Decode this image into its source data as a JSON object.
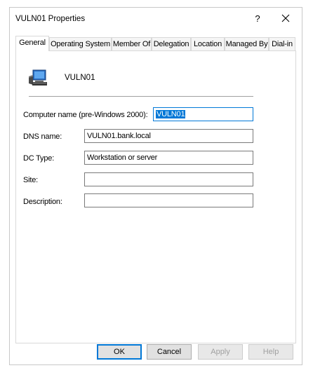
{
  "window": {
    "title": "VULN01 Properties",
    "help_label": "?",
    "close_icon": "close-icon"
  },
  "tabs": [
    {
      "label": "General",
      "active": true
    },
    {
      "label": "Operating System",
      "active": false
    },
    {
      "label": "Member Of",
      "active": false
    },
    {
      "label": "Delegation",
      "active": false
    },
    {
      "label": "Location",
      "active": false
    },
    {
      "label": "Managed By",
      "active": false
    },
    {
      "label": "Dial-in",
      "active": false
    }
  ],
  "general": {
    "icon": "computer-icon",
    "computer_name": "VULN01",
    "fields": {
      "pre_windows_2000": {
        "label": "Computer name (pre-Windows 2000):",
        "value": "VULN01"
      },
      "dns_name": {
        "label": "DNS name:",
        "value": "VULN01.bank.local"
      },
      "dc_type": {
        "label": "DC Type:",
        "value": "Workstation or server"
      },
      "site": {
        "label": "Site:",
        "value": ""
      },
      "description": {
        "label": "Description:",
        "value": ""
      }
    }
  },
  "buttons": {
    "ok": "OK",
    "cancel": "Cancel",
    "apply": "Apply",
    "help": "Help"
  },
  "colors": {
    "selection": "#0078d7",
    "focus_border": "#0078d7"
  }
}
